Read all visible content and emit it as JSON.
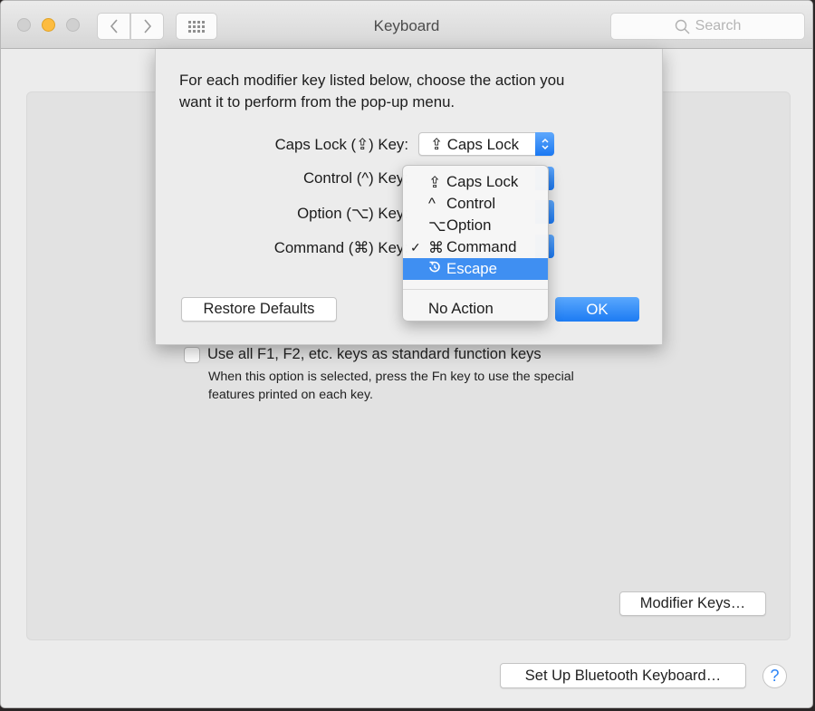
{
  "window": {
    "title": "Keyboard",
    "search_placeholder": "Search"
  },
  "main": {
    "fn_keys_checkbox": {
      "label": "Use all F1, F2, etc. keys as standard function keys",
      "checked": false,
      "help_line1": "When this option is selected, press the Fn key to use the special",
      "help_line2": "features printed on each key."
    },
    "modifier_keys_button": "Modifier Keys…",
    "bluetooth_button": "Set Up Bluetooth Keyboard…",
    "help_button": "?"
  },
  "sheet": {
    "intro_line1": "For each modifier key listed below, choose the action you",
    "intro_line2": "want it to perform from the pop-up menu.",
    "rows": [
      {
        "label": "Caps Lock (⇪) Key:",
        "value_glyph": "⇪",
        "value": "Caps Lock"
      },
      {
        "label": "Control (^) Key:",
        "value_glyph": "^",
        "value": "Control"
      },
      {
        "label": "Option (⌥) Key:",
        "value_glyph": "⌥",
        "value": "Option"
      },
      {
        "label": "Command (⌘) Key:",
        "value_glyph": "⌘",
        "value": "Command"
      }
    ],
    "restore_defaults": "Restore Defaults",
    "ok": "OK"
  },
  "menu": {
    "items": [
      {
        "glyph": "⇪",
        "label": "Caps Lock",
        "checked": false,
        "highlighted": false
      },
      {
        "glyph": "^",
        "label": "Control",
        "checked": false,
        "highlighted": false
      },
      {
        "glyph": "⌥",
        "label": "Option",
        "checked": false,
        "highlighted": false
      },
      {
        "glyph": "⌘",
        "label": "Command",
        "checked": true,
        "highlighted": false
      },
      {
        "glyph": "⎋",
        "label": "Escape",
        "checked": false,
        "highlighted": true
      }
    ],
    "check_glyph": "✓",
    "no_action": "No Action"
  },
  "colors": {
    "accent": "#3f8ff2",
    "minimize": "#fdbc40"
  }
}
